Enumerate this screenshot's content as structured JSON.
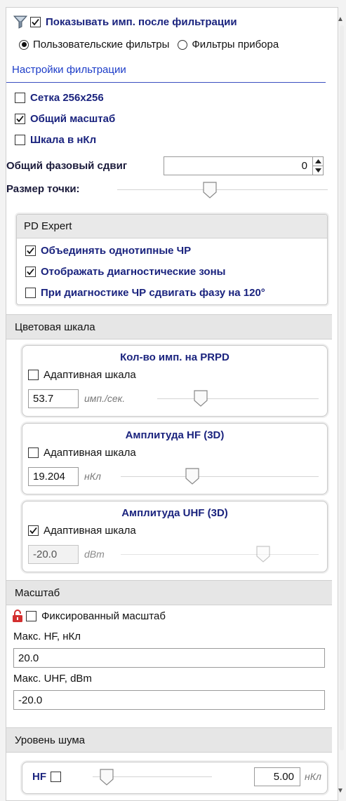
{
  "filter": {
    "show_after_filter_label": "Показывать имп. после фильтрации",
    "show_after_filter_checked": true,
    "radio_user_label": "Пользовательские фильтры",
    "radio_device_label": "Фильтры прибора",
    "radio_selected": "user",
    "settings_link": "Настройки фильтрации"
  },
  "display": {
    "grid_label": "Сетка 256x256",
    "grid_checked": false,
    "common_scale_label": "Общий масштаб",
    "common_scale_checked": true,
    "nc_scale_label": "Шкала в нКл",
    "nc_scale_checked": false,
    "phase_shift_label": "Общий фазовый сдвиг",
    "phase_shift_value": "0",
    "point_size_label": "Размер точки:",
    "point_size_level": 0.44
  },
  "pd_expert": {
    "header": "PD Expert",
    "items": [
      {
        "label": "Объединять однотипные ЧР",
        "checked": true
      },
      {
        "label": "Отображать диагностические зоны",
        "checked": true
      },
      {
        "label": "При диагностике ЧР сдвигать фазу на 120°",
        "checked": false
      }
    ]
  },
  "color_scale": {
    "header": "Цветовая шкала",
    "groups": [
      {
        "title": "Кол-во имп. на PRPD",
        "adaptive_label": "Адаптивная шкала",
        "adaptive_checked": false,
        "value": "53.7",
        "unit": "имп./сек.",
        "slider_level": 0.27,
        "disabled": false
      },
      {
        "title": "Амплитуда HF (3D)",
        "adaptive_label": "Адаптивная шкала",
        "adaptive_checked": false,
        "value": "19.204",
        "unit": "нКл",
        "slider_level": 0.36,
        "disabled": false
      },
      {
        "title": "Амплитуда UHF (3D)",
        "adaptive_label": "Адаптивная шкала",
        "adaptive_checked": true,
        "value": "-20.0",
        "unit": "dBm",
        "slider_level": 0.72,
        "disabled": true
      }
    ]
  },
  "scale": {
    "header": "Масштаб",
    "fixed_label": "Фиксированный масштаб",
    "fixed_checked": false,
    "max_hf_label": "Макс. HF, нКл",
    "max_hf_value": "20.0",
    "max_uhf_label": "Макс. UHF, dBm",
    "max_uhf_value": "-20.0"
  },
  "noise": {
    "header": "Уровень шума",
    "hf_label": "HF",
    "hf_checked": false,
    "hf_slider_level": 0.12,
    "hf_value": "5.00",
    "hf_unit": "нКл"
  },
  "colors": {
    "accent_text": "#1a237e",
    "link": "#1c3cc8",
    "lock_icon": "#d32f2f"
  }
}
